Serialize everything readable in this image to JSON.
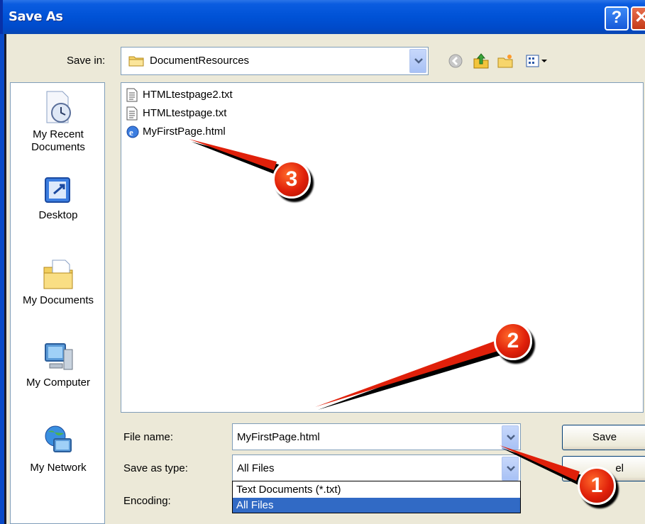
{
  "window": {
    "title": "Save As",
    "help_label": "?",
    "close_label": "✕"
  },
  "save_in": {
    "label": "Save in:",
    "value": "DocumentResources"
  },
  "toolbar": {
    "icons": [
      "back-icon",
      "up-folder-icon",
      "new-folder-icon",
      "views-menu-icon"
    ]
  },
  "places": [
    {
      "label_line1": "My Recent",
      "label_line2": "Documents",
      "icon": "recent-documents-icon"
    },
    {
      "label_line1": "Desktop",
      "label_line2": "",
      "icon": "desktop-icon"
    },
    {
      "label_line1": "My Documents",
      "label_line2": "",
      "icon": "my-documents-icon"
    },
    {
      "label_line1": "My Computer",
      "label_line2": "",
      "icon": "my-computer-icon"
    },
    {
      "label_line1": "My Network",
      "label_line2": "",
      "icon": "my-network-icon"
    }
  ],
  "files": [
    {
      "name": "HTMLtestpage2.txt",
      "icon": "text-file-icon"
    },
    {
      "name": "HTMLtestpage.txt",
      "icon": "text-file-icon"
    },
    {
      "name": "MyFirstPage.html",
      "icon": "html-file-icon"
    }
  ],
  "form": {
    "file_name_label": "File name:",
    "file_name_value": "MyFirstPage.html",
    "save_as_type_label": "Save as type:",
    "save_as_type_value": "All Files",
    "encoding_label": "Encoding:",
    "type_options": [
      "Text Documents (*.txt)",
      "All Files"
    ],
    "selected_option": "All Files"
  },
  "buttons": {
    "save_label": "Save",
    "cancel_label": "el"
  },
  "annotations": [
    "1",
    "2",
    "3"
  ],
  "colors": {
    "title_bar": "#0052d6",
    "selection": "#316ac5",
    "callout": "#e0200a",
    "dialog_bg": "#ece9d8"
  }
}
